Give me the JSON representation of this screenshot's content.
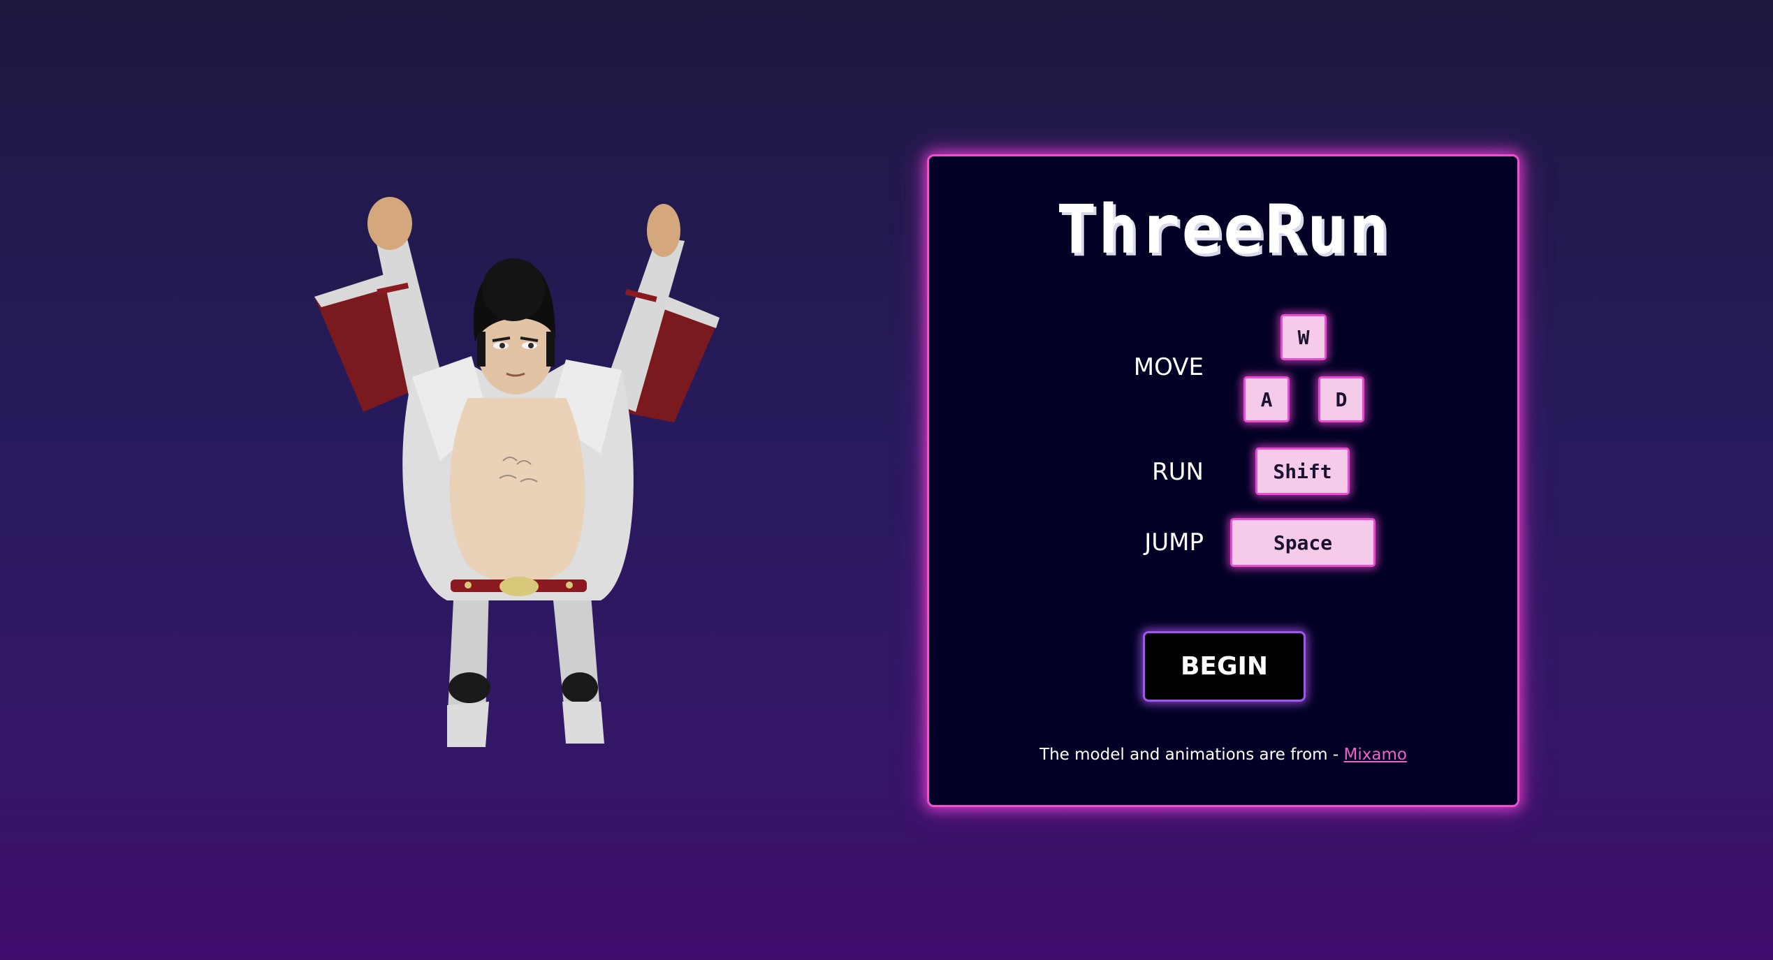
{
  "title": "ThreeRun",
  "controls": {
    "move_label": "MOVE",
    "run_label": "RUN",
    "jump_label": "JUMP",
    "keys": {
      "w": "W",
      "a": "A",
      "d": "D",
      "shift": "Shift",
      "space": "Space"
    }
  },
  "begin_label": "BEGIN",
  "credit": {
    "text": "The model and animations are from - ",
    "link_text": "Mixamo"
  },
  "colors": {
    "accent_pink": "#f04fd0",
    "key_fill": "#f5cbe9",
    "button_border": "#9f56f0",
    "panel_bg": "#020024",
    "link": "#f060c8"
  }
}
